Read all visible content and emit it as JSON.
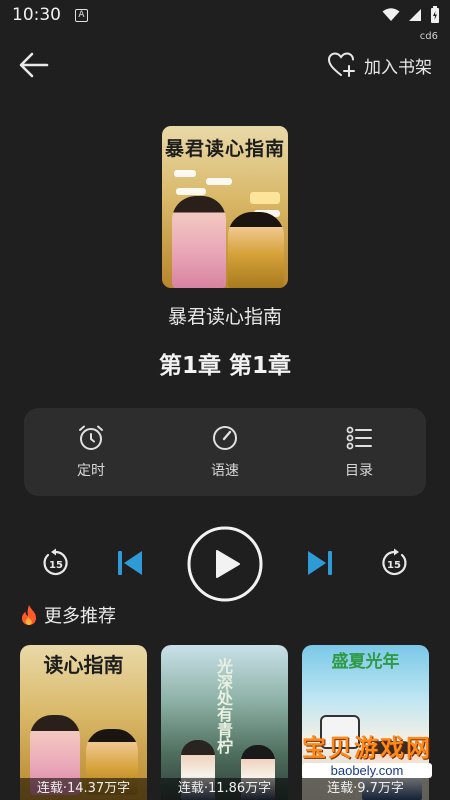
{
  "status": {
    "time": "10:30",
    "notif_letter": "A",
    "code": "cd6"
  },
  "topbar": {
    "add_bookshelf_label": "加入书架"
  },
  "book": {
    "title": "暴君读心指南",
    "cover_title": "暴君读心指南",
    "chapter": "第1章  第1章"
  },
  "controls": {
    "timer_label": "定时",
    "speed_label": "语速",
    "toc_label": "目录"
  },
  "player": {
    "rewind_seconds": "15",
    "forward_seconds": "15"
  },
  "recommend": {
    "title": "更多推荐",
    "cards": [
      {
        "status": "连载·14.37万字",
        "cover_text": "读心指南"
      },
      {
        "status": "连载·11.86万字",
        "cover_text": "光深处有青柠"
      },
      {
        "status": "连载·9.7万字",
        "cover_text": "盛夏光年"
      }
    ]
  },
  "watermark": {
    "brand": "宝贝游戏网",
    "url": "baobely.com"
  },
  "colors": {
    "accent": "#2e9bd6",
    "background": "#1f1f1f",
    "panel": "#2d2d2d"
  }
}
